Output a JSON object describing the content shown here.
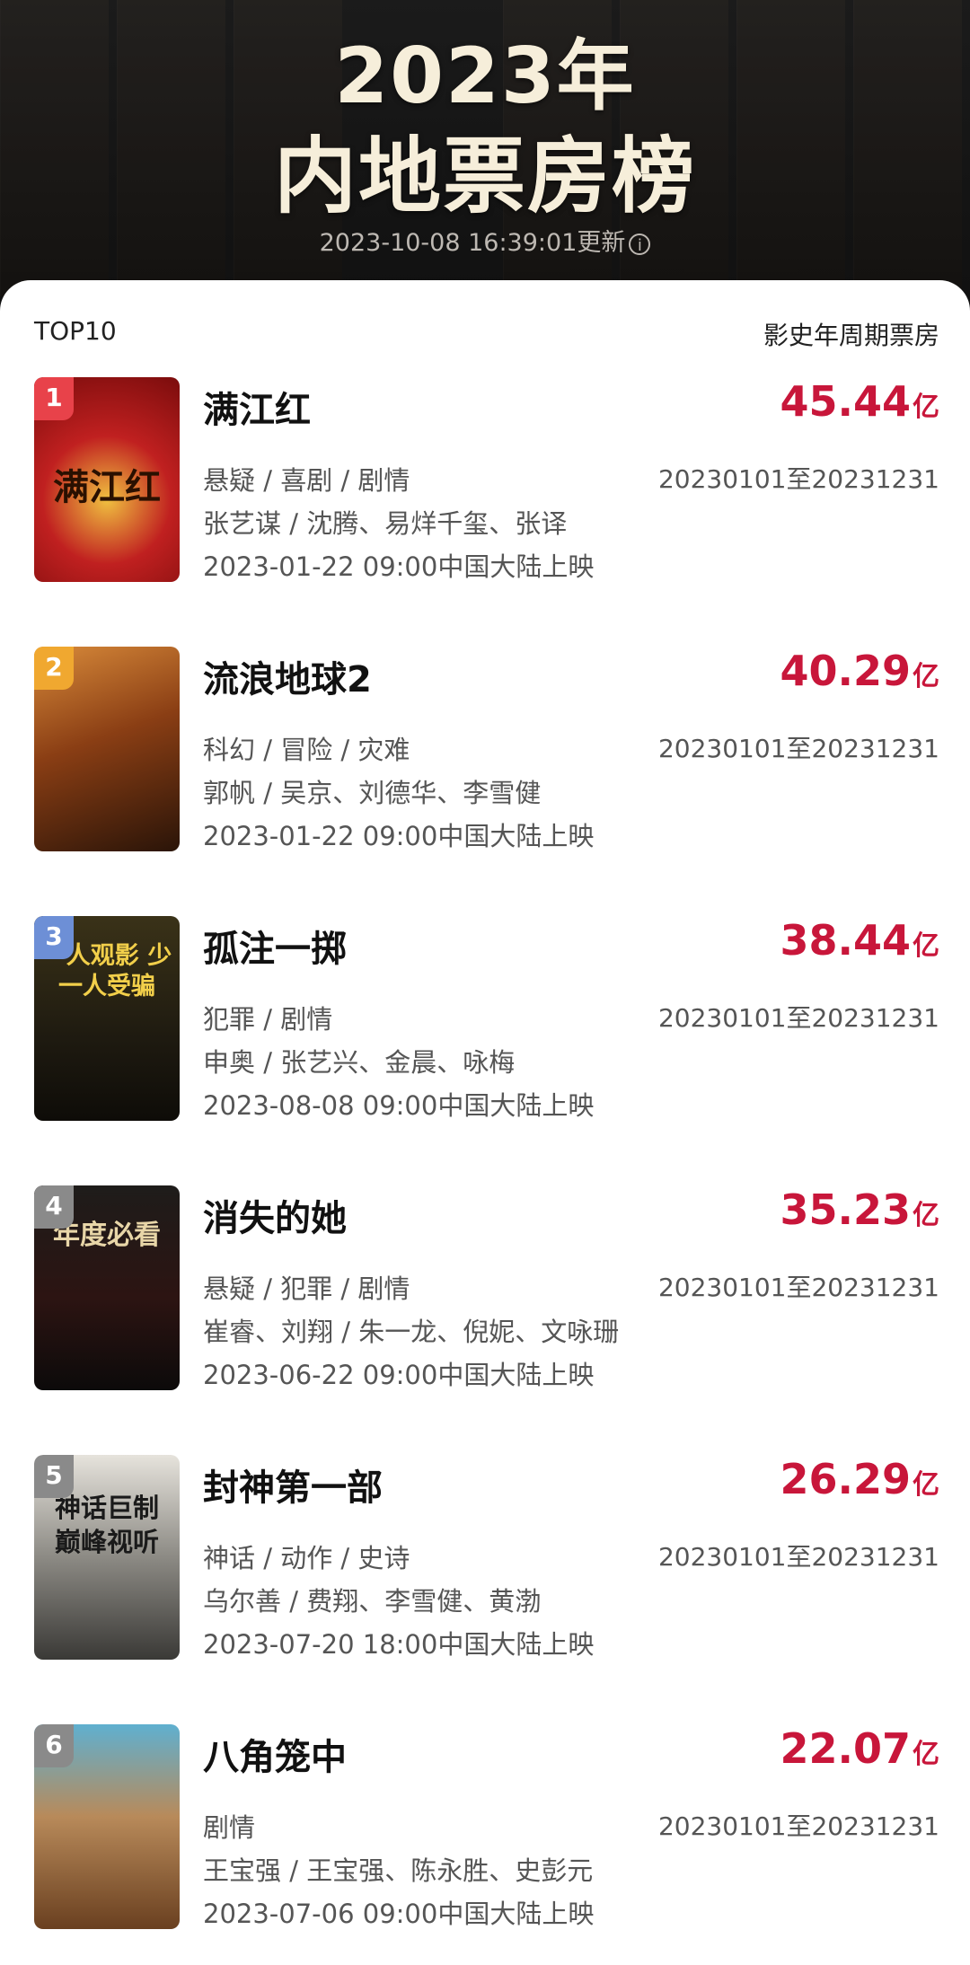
{
  "header": {
    "year_title": "2023年",
    "title": "内地票房榜",
    "updated": "2023-10-08 16:39:01更新",
    "info_icon": "info-circle-icon"
  },
  "list_header": {
    "left": "TOP10",
    "right": "影史年周期票房"
  },
  "colors": {
    "accent_red": "#c8163a",
    "rank1": "#e8424a",
    "rank2": "#f0a830",
    "rank3": "#6d8fd6",
    "rank_other": "#8a8a8a"
  },
  "movies": [
    {
      "rank": "1",
      "title": "满江红",
      "box_office": "45.44",
      "unit": "亿",
      "genres": "悬疑 / 喜剧 / 剧情",
      "period": "20230101至20231231",
      "cast": "张艺谋 / 沈腾、易烊千玺、张译",
      "release": "2023-01-22 09:00中国大陆上映"
    },
    {
      "rank": "2",
      "title": "流浪地球2",
      "box_office": "40.29",
      "unit": "亿",
      "genres": "科幻 / 冒险 / 灾难",
      "period": "20230101至20231231",
      "cast": "郭帆 / 吴京、刘德华、李雪健",
      "release": "2023-01-22 09:00中国大陆上映"
    },
    {
      "rank": "3",
      "title": "孤注一掷",
      "box_office": "38.44",
      "unit": "亿",
      "genres": "犯罪 / 剧情",
      "period": "20230101至20231231",
      "cast": "申奥 / 张艺兴、金晨、咏梅",
      "release": "2023-08-08 09:00中国大陆上映"
    },
    {
      "rank": "4",
      "title": "消失的她",
      "box_office": "35.23",
      "unit": "亿",
      "genres": "悬疑 / 犯罪 / 剧情",
      "period": "20230101至20231231",
      "cast": "崔睿、刘翔 / 朱一龙、倪妮、文咏珊",
      "release": "2023-06-22 09:00中国大陆上映"
    },
    {
      "rank": "5",
      "title": "封神第一部",
      "box_office": "26.29",
      "unit": "亿",
      "genres": "神话 / 动作 / 史诗",
      "period": "20230101至20231231",
      "cast": "乌尔善 / 费翔、李雪健、黄渤",
      "release": "2023-07-20 18:00中国大陆上映"
    },
    {
      "rank": "6",
      "title": "八角笼中",
      "box_office": "22.07",
      "unit": "亿",
      "genres": "剧情",
      "period": "20230101至20231231",
      "cast": "王宝强 / 王宝强、陈永胜、史彭元",
      "release": "2023-07-06 09:00中国大陆上映"
    }
  ],
  "poster_text": {
    "p1": "满江红",
    "p3": "一人观影 少一人受骗",
    "p4": "年度必看",
    "p5": "神话巨制 巅峰视听"
  }
}
